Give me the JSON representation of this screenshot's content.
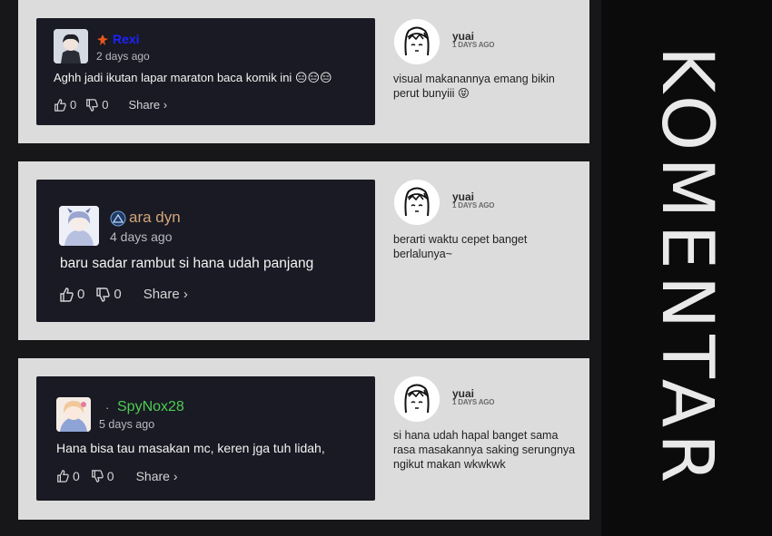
{
  "page_title": "KOMENTAR",
  "comments": [
    {
      "username": "Rexi",
      "time": "2 days ago",
      "text": "Aghh jadi ikutan lapar maraton baca komik ini 😑😑😑",
      "likes": "0",
      "dislikes": "0",
      "share_label": "Share ›",
      "name_color": "#1d22ff",
      "reply": {
        "username": "yuai",
        "time": "1 DAYS AGO",
        "text": "visual makanannya emang bikin perut bunyiii 😝"
      }
    },
    {
      "username": "ara dyn",
      "time": "4 days ago",
      "text": "baru sadar rambut si hana udah panjang",
      "likes": "0",
      "dislikes": "0",
      "share_label": "Share ›",
      "name_color": "#d3a57a",
      "reply": {
        "username": "yuai",
        "time": "1 DAYS AGO",
        "text": "berarti waktu cepet banget berlalunya~"
      }
    },
    {
      "username": "SpyNox28",
      "time": "5 days ago",
      "text": "Hana bisa tau masakan mc, keren jga tuh lidah,",
      "likes": "0",
      "dislikes": "0",
      "share_label": "Share ›",
      "name_color": "#4ccc52",
      "reply": {
        "username": "yuai",
        "time": "1 DAYS AGO",
        "text": "si hana udah hapal banget sama rasa masakannya saking serungnya ngikut makan wkwkwk"
      }
    }
  ]
}
